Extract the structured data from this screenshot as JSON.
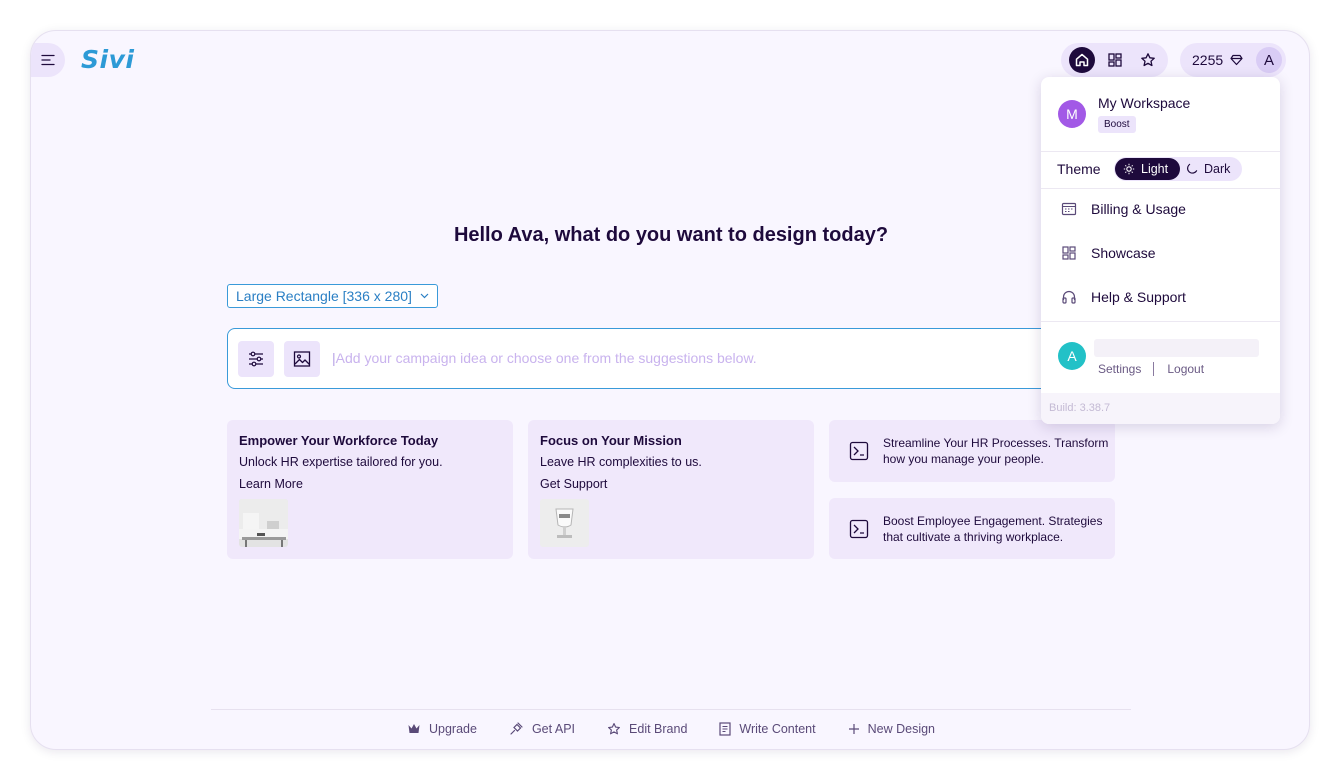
{
  "app": {
    "logo": "Sivi"
  },
  "header": {
    "credits": "2255",
    "user_initial": "A",
    "nav": [
      {
        "icon": "home-icon",
        "active": true
      },
      {
        "icon": "grid-icon",
        "active": false
      },
      {
        "icon": "star-icon",
        "active": false
      }
    ]
  },
  "main": {
    "greeting": "Hello Ava, what do you want to design today?",
    "size_select": "Large Rectangle [336 x 280]",
    "prompt_placeholder": "Add your campaign idea or choose one from the suggestions below.",
    "prompt_caret": "|"
  },
  "cards": [
    {
      "title": "Empower Your Workforce Today",
      "subtitle": "Unlock HR expertise tailored for you.",
      "link": "Learn More"
    },
    {
      "title": "Focus on Your Mission",
      "subtitle": "Leave HR complexities to us.",
      "link": "Get Support"
    }
  ],
  "suggestions": [
    {
      "line1": "Streamline Your HR Processes. Transform",
      "line2": "how you manage your people."
    },
    {
      "line1": "Boost Employee Engagement. Strategies",
      "line2": "that cultivate a thriving workplace."
    }
  ],
  "bottom_bar": [
    {
      "label": "Upgrade",
      "icon": "crown-icon"
    },
    {
      "label": "Get API",
      "icon": "plug-icon"
    },
    {
      "label": "Edit Brand",
      "icon": "star-icon"
    },
    {
      "label": "Write Content",
      "icon": "document-icon"
    },
    {
      "label": "New Design",
      "icon": "plus-icon"
    }
  ],
  "dropdown": {
    "workspace_initial": "M",
    "workspace_name": "My Workspace",
    "workspace_plan": "Boost",
    "theme_label": "Theme",
    "theme_light": "Light",
    "theme_dark": "Dark",
    "theme_selected": "Light",
    "items": [
      {
        "label": "Billing & Usage",
        "icon": "billing-icon"
      },
      {
        "label": "Showcase",
        "icon": "showcase-icon"
      },
      {
        "label": "Help & Support",
        "icon": "headset-icon"
      }
    ],
    "user_initial": "A",
    "settings": "Settings",
    "logout": "Logout",
    "build": "Build: 3.38.7"
  },
  "colors": {
    "background": "#f9f6ff",
    "accent_dark": "#1e0a3c",
    "accent_light": "#ece4fb",
    "link_blue": "#3a9ad9",
    "logo": "#2d9ad6"
  }
}
